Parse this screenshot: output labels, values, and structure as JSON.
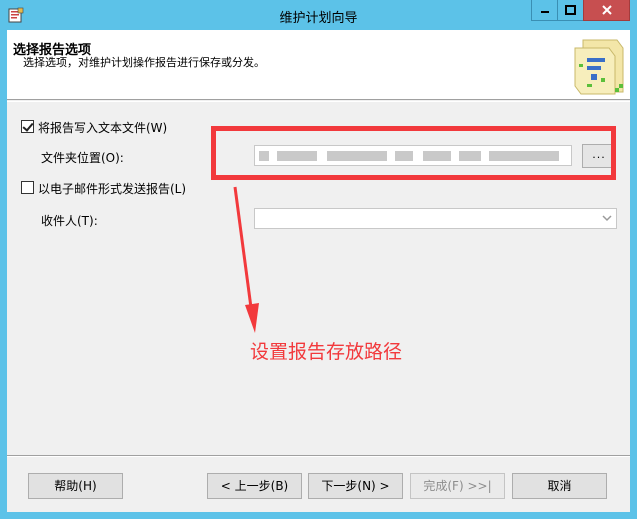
{
  "window": {
    "title": "维护计划向导"
  },
  "header": {
    "title": "选择报告选项",
    "subtitle": "选择选项，对维护计划操作报告进行保存或分发。"
  },
  "options": {
    "write_text_file_label": "将报告写入文本文件(W)",
    "write_text_file_checked": true,
    "folder_label": "文件夹位置(O):",
    "folder_value": "",
    "browse_label": "...",
    "email_label": "以电子邮件形式发送报告(L)",
    "email_checked": false,
    "recipient_label": "收件人(T):",
    "recipient_value": ""
  },
  "annotation": {
    "text": "设置报告存放路径",
    "color": "#f2393c"
  },
  "buttons": {
    "help": "帮助(H)",
    "back": "< 上一步(B)",
    "next": "下一步(N) >",
    "finish": "完成(F) >>|",
    "cancel": "取消"
  },
  "icons": {
    "app": "maintenance-plan-icon",
    "minimize": "minimize-icon",
    "maximize": "maximize-icon",
    "close": "close-icon",
    "wizard": "wizard-banner-icon",
    "dropdown": "chevron-down-icon"
  }
}
